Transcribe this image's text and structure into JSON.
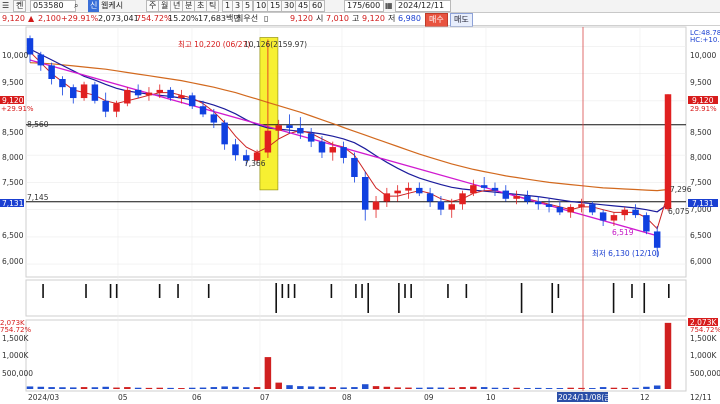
{
  "toolbar": {
    "dropdown": "켄",
    "code": "053580",
    "search_icon": "search-icon",
    "news_badge": "신",
    "period_label": "웹케시",
    "period_buttons": [
      "주",
      "월",
      "년",
      "분",
      "초",
      "틱"
    ],
    "minute_buttons": [
      "1",
      "3",
      "5",
      "10",
      "15",
      "30",
      "45",
      "60"
    ],
    "count": "175/600",
    "date": "2024/12/11"
  },
  "quote": {
    "price": "9,120",
    "change": "2,100",
    "change_pct": "+29.91%",
    "volume": "2,073,041",
    "volume_ratio": "754.72%",
    "turnover_ratio": "15.20%",
    "amount": "17,683백만",
    "note": "최우선",
    "last": "9,120",
    "open_label": "시",
    "open": "7,010",
    "high_label": "고",
    "high": "9,120",
    "low_label": "저",
    "low": "6,980",
    "sell_label": "매수",
    "buy_label": "매도"
  },
  "chart": {
    "high_annot": "최고 10,220 (06/27)",
    "boxed_annot": "10,126(2159.97)",
    "low_annot": "최저 6,130 (12/10)",
    "left_tags": [
      "9,120",
      "+29.91%",
      "7,131"
    ],
    "right_tags": [
      "LC:48.78",
      "HC:+10.76",
      "9,120",
      "29.91%",
      "2,073K",
      "754.72%"
    ],
    "hlines": [
      "8,560",
      "7,145"
    ],
    "point_labels": [
      "7,366",
      "7,296",
      "6,519",
      "6,075"
    ],
    "price_axis": [
      "10,000",
      "9,500",
      "9,000",
      "8,500",
      "8,000",
      "7,500",
      "7,000",
      "6,500",
      "6,000"
    ],
    "volume_axis": [
      "1,500K",
      "1,000K",
      "500,000"
    ],
    "date_axis": [
      "2024/03",
      "05",
      "06",
      "07",
      "08",
      "09",
      "10",
      "2024/11/08(금)",
      "12",
      "12/11"
    ]
  },
  "chart_data": {
    "type": "candlestick",
    "ylim": [
      5800,
      10300
    ],
    "ohlc": [
      [
        10150,
        10200,
        9700,
        9850
      ],
      [
        9850,
        9900,
        9550,
        9650
      ],
      [
        9650,
        9700,
        9300,
        9400
      ],
      [
        9400,
        9450,
        9100,
        9250
      ],
      [
        9250,
        9300,
        8950,
        9050
      ],
      [
        9050,
        9350,
        9000,
        9300
      ],
      [
        9300,
        9350,
        8950,
        9000
      ],
      [
        9000,
        9150,
        8700,
        8800
      ],
      [
        8800,
        9000,
        8700,
        8950
      ],
      [
        8950,
        9250,
        8900,
        9200
      ],
      [
        9200,
        9300,
        9050,
        9100
      ],
      [
        9100,
        9250,
        9000,
        9150
      ],
      [
        9150,
        9300,
        9050,
        9200
      ],
      [
        9200,
        9250,
        9000,
        9050
      ],
      [
        9050,
        9200,
        8950,
        9100
      ],
      [
        9100,
        9150,
        8850,
        8900
      ],
      [
        8900,
        9000,
        8700,
        8750
      ],
      [
        8750,
        8850,
        8500,
        8600
      ],
      [
        8600,
        8650,
        8100,
        8200
      ],
      [
        8200,
        8300,
        7900,
        8000
      ],
      [
        8000,
        8100,
        7800,
        7900
      ],
      [
        7900,
        8100,
        7850,
        8050
      ],
      [
        8050,
        10126,
        7950,
        8450
      ],
      [
        8450,
        8650,
        8300,
        8550
      ],
      [
        8550,
        8750,
        8400,
        8500
      ],
      [
        8500,
        8700,
        8300,
        8400
      ],
      [
        8400,
        8500,
        8150,
        8250
      ],
      [
        8250,
        8350,
        7950,
        8050
      ],
      [
        8050,
        8250,
        7900,
        8150
      ],
      [
        8150,
        8250,
        7850,
        7950
      ],
      [
        7950,
        8050,
        7500,
        7600
      ],
      [
        7600,
        7700,
        6800,
        7000
      ],
      [
        7000,
        7250,
        6850,
        7150
      ],
      [
        7150,
        7400,
        7050,
        7300
      ],
      [
        7300,
        7450,
        7150,
        7350
      ],
      [
        7350,
        7500,
        7200,
        7400
      ],
      [
        7400,
        7500,
        7250,
        7300
      ],
      [
        7300,
        7400,
        7050,
        7150
      ],
      [
        7150,
        7250,
        6900,
        7000
      ],
      [
        7000,
        7200,
        6850,
        7100
      ],
      [
        7100,
        7350,
        7000,
        7300
      ],
      [
        7300,
        7550,
        7250,
        7450
      ],
      [
        7450,
        7600,
        7350,
        7400
      ],
      [
        7400,
        7500,
        7250,
        7350
      ],
      [
        7350,
        7450,
        7150,
        7200
      ],
      [
        7200,
        7350,
        7100,
        7250
      ],
      [
        7250,
        7350,
        7100,
        7150
      ],
      [
        7150,
        7250,
        7000,
        7100
      ],
      [
        7100,
        7200,
        6950,
        7050
      ],
      [
        7050,
        7150,
        6900,
        6950
      ],
      [
        6950,
        7100,
        6850,
        7050
      ],
      [
        7050,
        7200,
        6950,
        7100
      ],
      [
        7100,
        7150,
        6900,
        6950
      ],
      [
        6950,
        7000,
        6700,
        6800
      ],
      [
        6800,
        6950,
        6700,
        6900
      ],
      [
        6900,
        7050,
        6800,
        7000
      ],
      [
        7000,
        7100,
        6850,
        6900
      ],
      [
        6900,
        6950,
        6550,
        6600
      ],
      [
        6600,
        6700,
        6130,
        6300
      ],
      [
        7010,
        9120,
        6980,
        9120
      ]
    ],
    "ma_short": [
      9900,
      9700,
      9500,
      9350,
      9200,
      9150,
      9100,
      9000,
      8950,
      9000,
      9050,
      9100,
      9150,
      9150,
      9100,
      9050,
      8950,
      8800,
      8600,
      8350,
      8150,
      8050,
      8150,
      8300,
      8400,
      8450,
      8400,
      8300,
      8200,
      8150,
      8000,
      7700,
      7400,
      7250,
      7250,
      7300,
      7350,
      7300,
      7200,
      7150,
      7200,
      7300,
      7350,
      7350,
      7300,
      7250,
      7200,
      7150,
      7100,
      7050,
      7000,
      7050,
      7050,
      7000,
      6950,
      6950,
      6950,
      6850,
      6650,
      7300
    ],
    "ma_mid": [
      9950,
      9850,
      9750,
      9650,
      9550,
      9450,
      9380,
      9300,
      9230,
      9180,
      9150,
      9120,
      9100,
      9080,
      9050,
      9020,
      8980,
      8920,
      8850,
      8760,
      8650,
      8560,
      8500,
      8480,
      8460,
      8440,
      8420,
      8390,
      8350,
      8300,
      8230,
      8120,
      7990,
      7870,
      7760,
      7660,
      7580,
      7520,
      7460,
      7410,
      7380,
      7360,
      7340,
      7320,
      7300,
      7280,
      7260,
      7240,
      7210,
      7180,
      7150,
      7130,
      7110,
      7090,
      7070,
      7050,
      7030,
      7000,
      6960,
      7100
    ],
    "ma_long": [
      9700,
      9690,
      9680,
      9660,
      9640,
      9620,
      9600,
      9580,
      9550,
      9520,
      9490,
      9460,
      9430,
      9400,
      9370,
      9330,
      9290,
      9250,
      9200,
      9150,
      9090,
      9030,
      8970,
      8910,
      8850,
      8790,
      8720,
      8650,
      8580,
      8510,
      8440,
      8370,
      8300,
      8230,
      8160,
      8090,
      8020,
      7960,
      7900,
      7840,
      7790,
      7740,
      7700,
      7660,
      7620,
      7590,
      7560,
      7530,
      7500,
      7480,
      7460,
      7440,
      7420,
      7400,
      7390,
      7380,
      7370,
      7360,
      7350,
      7370
    ],
    "trend_line": [
      [
        0,
        9750
      ],
      [
        58,
        6520
      ]
    ],
    "hline_values": [
      8560,
      7145
    ],
    "volume": [
      80,
      70,
      60,
      55,
      50,
      60,
      55,
      70,
      45,
      60,
      40,
      35,
      40,
      35,
      30,
      40,
      45,
      60,
      80,
      70,
      55,
      60,
      1000,
      200,
      120,
      90,
      80,
      70,
      60,
      50,
      60,
      150,
      90,
      70,
      50,
      45,
      40,
      50,
      45,
      40,
      60,
      70,
      60,
      40,
      35,
      40,
      30,
      35,
      30,
      30,
      40,
      35,
      30,
      60,
      40,
      35,
      40,
      70,
      110,
      2073
    ],
    "volume_ylim": [
      0,
      2100
    ]
  }
}
